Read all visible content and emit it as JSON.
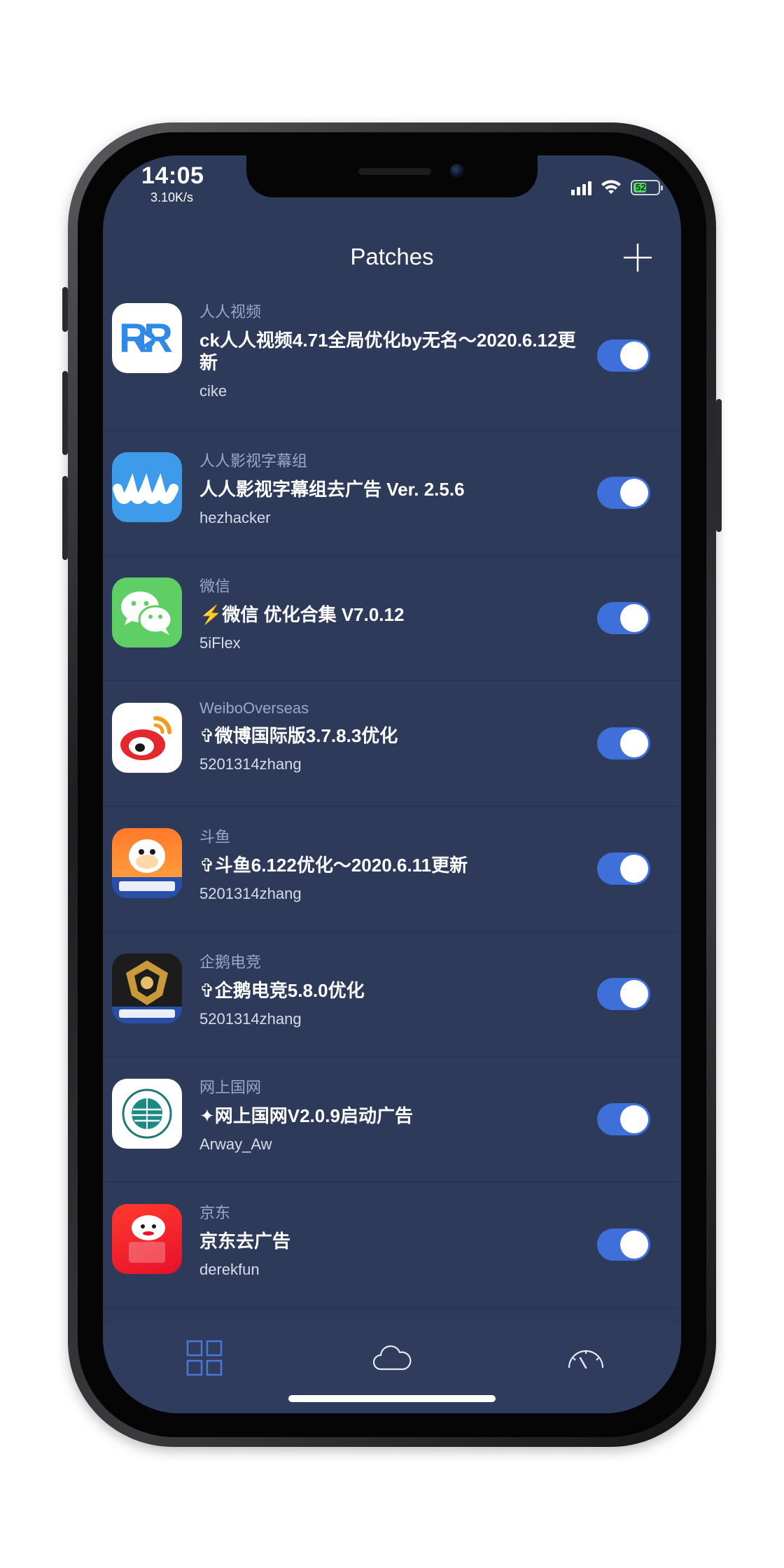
{
  "status_bar": {
    "time": "14:05",
    "speed": "3.10K/s",
    "battery": "52"
  },
  "navbar": {
    "title": "Patches",
    "add_icon": "plus-icon"
  },
  "patches": [
    {
      "app": "人人视频",
      "title": "ck人人视频4.71全局优化by无名～2020.6.12更新",
      "author": "cike",
      "enabled": true,
      "icon": "rr-video-app-icon"
    },
    {
      "app": "人人影视字幕组",
      "title": "人人影视字幕组去广告 Ver. 2.5.6",
      "author": "hezhacker",
      "enabled": true,
      "icon": "rr-subtitle-app-icon"
    },
    {
      "app": "微信",
      "title": "⚡️微信 优化合集 V7.0.12",
      "author": "5iFlex",
      "enabled": true,
      "icon": "wechat-app-icon"
    },
    {
      "app": "WeiboOverseas",
      "title": "✞微博国际版3.7.8.3优化",
      "author": "5201314zhang",
      "enabled": true,
      "icon": "weibo-app-icon"
    },
    {
      "app": "斗鱼",
      "title": "✞斗鱼6.122优化～2020.6.11更新",
      "author": "5201314zhang",
      "enabled": true,
      "icon": "douyu-app-icon"
    },
    {
      "app": "企鹅电竞",
      "title": "✞企鹅电竞5.8.0优化",
      "author": "5201314zhang",
      "enabled": true,
      "icon": "penguin-esports-app-icon"
    },
    {
      "app": "网上国网",
      "title": "✦网上国网V2.0.9启动广告",
      "author": "Arway_Aw",
      "enabled": true,
      "icon": "state-grid-app-icon"
    },
    {
      "app": "京东",
      "title": "京东去广告",
      "author": "derekfun",
      "enabled": true,
      "icon": "jd-app-icon"
    }
  ],
  "tabbar": {
    "tabs": [
      "grid-icon",
      "cloud-icon",
      "speedometer-icon"
    ],
    "active": "grid-icon",
    "accent": "#4a78d9"
  },
  "colors": {
    "background": "#2d3a5a",
    "toggle_on": "#3f6fd8",
    "subtitle": "#9aa7c6"
  }
}
